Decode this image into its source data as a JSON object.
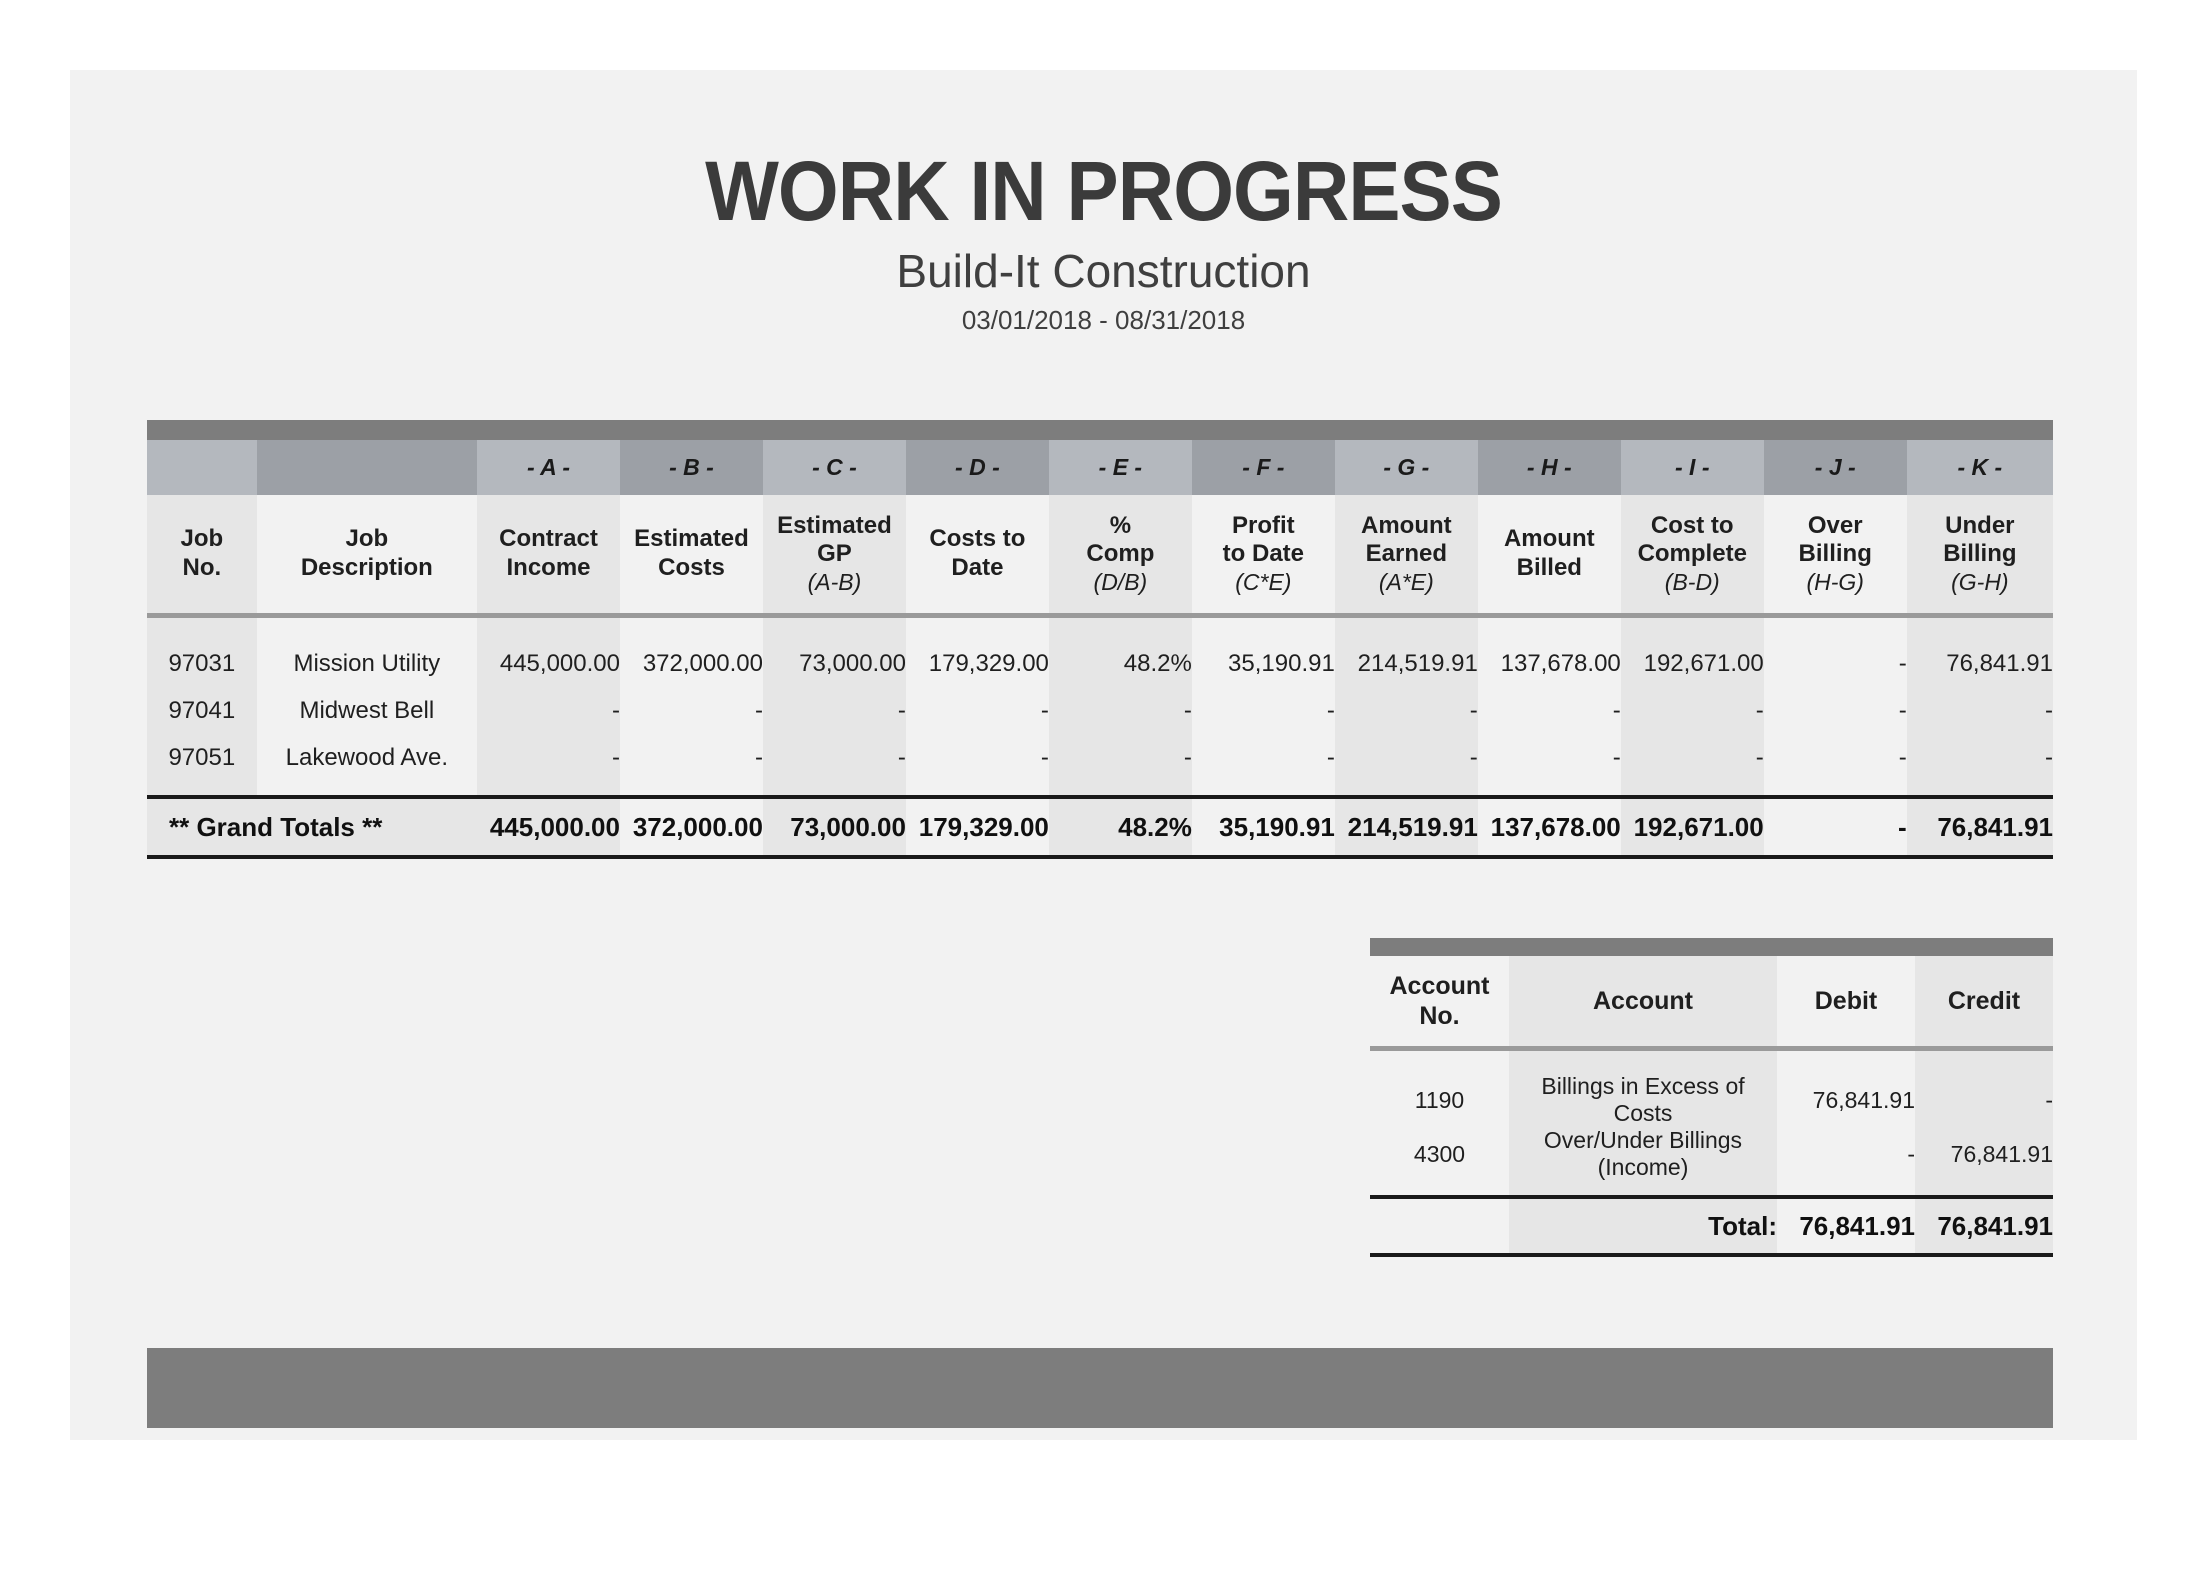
{
  "report": {
    "title": "WORK IN PROGRESS",
    "company": "Build-It Construction",
    "date_range": "03/01/2018 - 08/31/2018"
  },
  "colors": {
    "page_background": "#f2f2f2",
    "dark_strip": "#7d7d7d",
    "letter_row_light": "#b4b8be",
    "letter_row_dark": "#9ca0a6",
    "column_light": "#e6e6e6",
    "column_dark": "#f2f2f2",
    "rule": "#9a9a9a",
    "text": "#1f1f1f"
  },
  "wip_table": {
    "letters": [
      "",
      "",
      "- A -",
      "- B -",
      "- C -",
      "- D -",
      "- E -",
      "- F -",
      "- G -",
      "- H -",
      "- I -",
      "- J -",
      "- K -"
    ],
    "headers": [
      {
        "line1": "Job",
        "line2": "No.",
        "formula": ""
      },
      {
        "line1": "Job",
        "line2": "Description",
        "formula": ""
      },
      {
        "line1": "Contract",
        "line2": "Income",
        "formula": ""
      },
      {
        "line1": "Estimated",
        "line2": "Costs",
        "formula": ""
      },
      {
        "line1": "Estimated",
        "line2": "GP",
        "formula": "(A-B)"
      },
      {
        "line1": "Costs to",
        "line2": "Date",
        "formula": ""
      },
      {
        "line1": "%",
        "line2": "Comp",
        "formula": "(D/B)"
      },
      {
        "line1": "Profit",
        "line2": "to Date",
        "formula": "(C*E)"
      },
      {
        "line1": "Amount",
        "line2": "Earned",
        "formula": "(A*E)"
      },
      {
        "line1": "Amount",
        "line2": "Billed",
        "formula": ""
      },
      {
        "line1": "Cost to",
        "line2": "Complete",
        "formula": "(B-D)"
      },
      {
        "line1": "Over",
        "line2": "Billing",
        "formula": "(H-G)"
      },
      {
        "line1": "Under",
        "line2": "Billing",
        "formula": "(G-H)"
      }
    ],
    "rows": [
      {
        "job_no": "97031",
        "job_description": "Mission Utility",
        "contract_income": "445,000.00",
        "estimated_costs": "372,000.00",
        "estimated_gp": "73,000.00",
        "costs_to_date": "179,329.00",
        "pct_comp": "48.2%",
        "profit_to_date": "35,190.91",
        "amount_earned": "214,519.91",
        "amount_billed": "137,678.00",
        "cost_to_complete": "192,671.00",
        "over_billing": "-",
        "under_billing": "76,841.91"
      },
      {
        "job_no": "97041",
        "job_description": "Midwest Bell",
        "contract_income": "-",
        "estimated_costs": "-",
        "estimated_gp": "-",
        "costs_to_date": "-",
        "pct_comp": "-",
        "profit_to_date": "-",
        "amount_earned": "-",
        "amount_billed": "-",
        "cost_to_complete": "-",
        "over_billing": "-",
        "under_billing": "-"
      },
      {
        "job_no": "97051",
        "job_description": "Lakewood Ave.",
        "contract_income": "-",
        "estimated_costs": "-",
        "estimated_gp": "-",
        "costs_to_date": "-",
        "pct_comp": "-",
        "profit_to_date": "-",
        "amount_earned": "-",
        "amount_billed": "-",
        "cost_to_complete": "-",
        "over_billing": "-",
        "under_billing": "-"
      }
    ],
    "totals": {
      "label": "** Grand Totals **",
      "contract_income": "445,000.00",
      "estimated_costs": "372,000.00",
      "estimated_gp": "73,000.00",
      "costs_to_date": "179,329.00",
      "pct_comp": "48.2%",
      "profit_to_date": "35,190.91",
      "amount_earned": "214,519.91",
      "amount_billed": "137,678.00",
      "cost_to_complete": "192,671.00",
      "over_billing": "-",
      "under_billing": "76,841.91"
    }
  },
  "journal_table": {
    "headers": [
      {
        "line1": "Account",
        "line2": "No."
      },
      {
        "line1": "Account",
        "line2": ""
      },
      {
        "line1": "Debit",
        "line2": ""
      },
      {
        "line1": "Credit",
        "line2": ""
      }
    ],
    "rows": [
      {
        "account_no": "1190",
        "account": "Billings in Excess of Costs",
        "debit": "76,841.91",
        "credit": "-"
      },
      {
        "account_no": "4300",
        "account": "Over/Under Billings (Income)",
        "debit": "-",
        "credit": "76,841.91"
      }
    ],
    "totals": {
      "label": "Total:",
      "debit": "76,841.91",
      "credit": "76,841.91"
    }
  }
}
